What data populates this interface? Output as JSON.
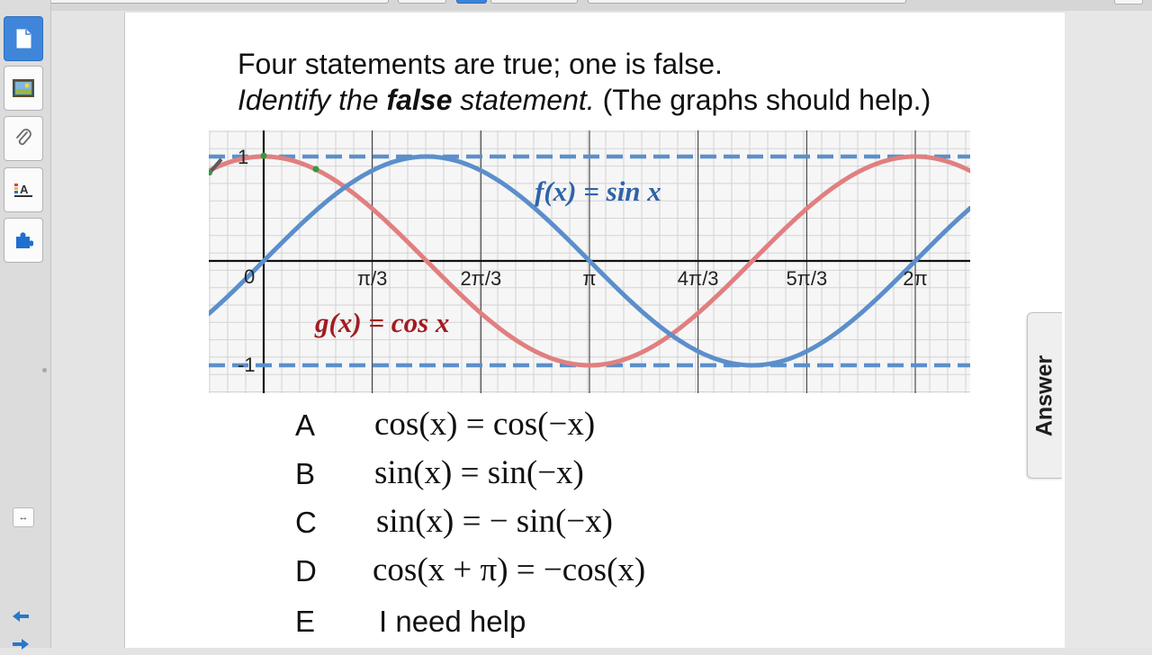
{
  "prompt": {
    "line1": "Four statements are true; one is false.",
    "line2_part1": "Identify the ",
    "line2_bold": "false",
    "line2_part2": " statement.",
    "line2_part3": " (The graphs should help.)"
  },
  "graph": {
    "sine_label": "f(x) = sin x",
    "cosine_label": "g(x) = cos x",
    "y_tick_top": "1",
    "y_tick_bottom": "-1",
    "origin_label": "0",
    "x_tick_labels": [
      "π/3",
      "2π/3",
      "π",
      "4π/3",
      "5π/3",
      "2π"
    ],
    "colors": {
      "sine": "#5b8fcb",
      "cosine": "#e17f80",
      "sine_label": "#2f63a8",
      "cosine_label": "#a11c22",
      "grid": "#c9c9c9"
    }
  },
  "choices": [
    {
      "letter": "A",
      "statement": "cos(x) = cos(−x)"
    },
    {
      "letter": "B",
      "statement": "sin(x) = sin(−x)"
    },
    {
      "letter": "C",
      "statement": "sin(x) = − sin(−x)"
    },
    {
      "letter": "D",
      "statement": "cos(x + π) = −cos(x)"
    },
    {
      "letter": "E",
      "statement": "I need help"
    }
  ],
  "answer_tab": {
    "label": "Answer"
  },
  "sidebar": {
    "tabs": [
      "page-sorter-icon",
      "gallery-icon",
      "attachments-icon",
      "properties-icon",
      "addons-icon"
    ],
    "resize_glyph": "↔",
    "prev_glyph": "🡄",
    "next_glyph": "🡆"
  }
}
